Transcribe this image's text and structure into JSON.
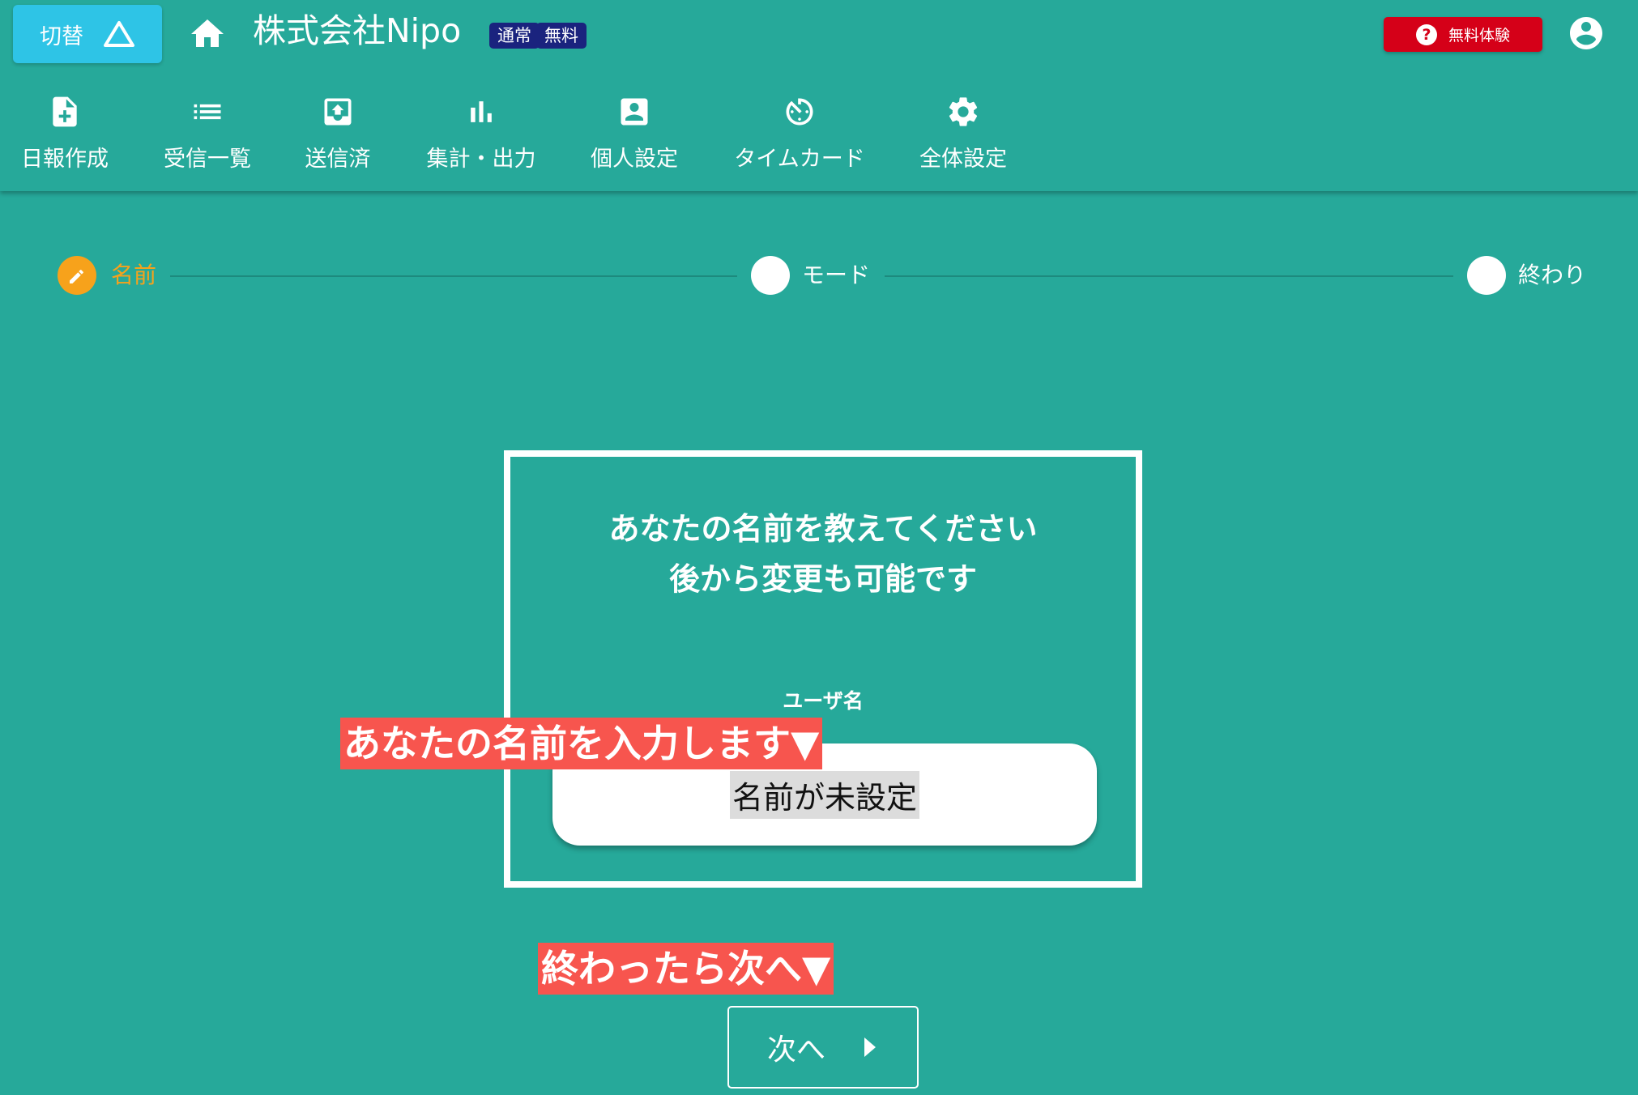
{
  "header": {
    "switch_label": "切替",
    "company_name": "株式会社Nipo",
    "badges": [
      "通常",
      "無料"
    ],
    "trial_label": "無料体験"
  },
  "nav": [
    {
      "label": "日報作成",
      "icon": "note-add-icon"
    },
    {
      "label": "受信一覧",
      "icon": "list-icon"
    },
    {
      "label": "送信済",
      "icon": "outbox-icon"
    },
    {
      "label": "集計・出力",
      "icon": "bar-chart-icon"
    },
    {
      "label": "個人設定",
      "icon": "account-box-icon"
    },
    {
      "label": "タイムカード",
      "icon": "timer-icon"
    },
    {
      "label": "全体設定",
      "icon": "gear-icon"
    }
  ],
  "stepper": {
    "steps": [
      {
        "label": "名前",
        "state": "active"
      },
      {
        "label": "モード",
        "state": "pending"
      },
      {
        "label": "終わり",
        "state": "pending"
      }
    ]
  },
  "card": {
    "title_line1": "あなたの名前を教えてください",
    "title_line2": "後から変更も可能です",
    "field_label": "ユーザ名",
    "input_value": "名前が未設定"
  },
  "annotations": {
    "input_hint": "あなたの名前を入力します▼",
    "next_hint": "終わったら次へ▼"
  },
  "next_button_label": "次へ",
  "colors": {
    "background": "#26a99a",
    "switch_button": "#2ec4e6",
    "badge": "#1a237e",
    "trial_button": "#d50018",
    "active_step": "#f7a21b",
    "annotation": "#f7554e"
  }
}
